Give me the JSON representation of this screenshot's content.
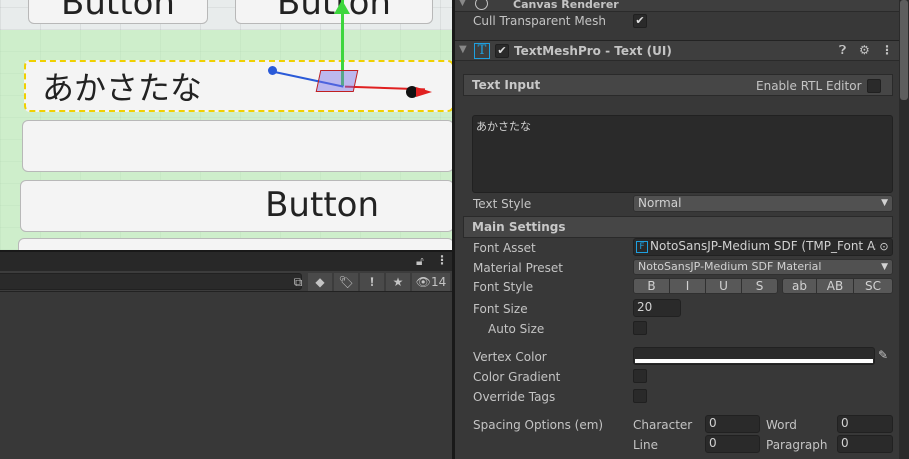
{
  "scene": {
    "button_label": "Button",
    "selected_text": "あかさたな"
  },
  "hierarchy": {
    "visible_count": "14"
  },
  "inspector": {
    "canvas_renderer_title": "Canvas Renderer",
    "cull_transparent_mesh_label": "Cull Transparent Mesh",
    "cull_transparent_mesh": true,
    "component_title": "TextMeshPro - Text (UI)",
    "component_enabled": true,
    "text_input": {
      "header": "Text Input",
      "rtl_label": "Enable RTL Editor",
      "rtl": false,
      "value": "あかさたな"
    },
    "text_style": {
      "label": "Text Style",
      "value": "Normal"
    },
    "main_settings": {
      "header": "Main Settings",
      "font_asset": {
        "label": "Font Asset",
        "value": "NotoSansJP-Medium SDF (TMP_Font Asset)"
      },
      "material_preset": {
        "label": "Material Preset",
        "value": "NotoSansJP-Medium SDF Material"
      },
      "font_style": {
        "label": "Font Style",
        "buttons": [
          "B",
          "I",
          "U",
          "S",
          "ab",
          "AB",
          "SC"
        ]
      },
      "font_size": {
        "label": "Font Size",
        "value": "20"
      },
      "auto_size": {
        "label": "Auto Size",
        "value": false
      },
      "vertex_color": {
        "label": "Vertex Color",
        "value": "#ffffff"
      },
      "color_gradient": {
        "label": "Color Gradient",
        "value": false
      },
      "override_tags": {
        "label": "Override Tags",
        "value": false
      },
      "spacing": {
        "label": "Spacing Options (em)",
        "character_label": "Character",
        "character": "0",
        "word_label": "Word",
        "word": "0",
        "line_label": "Line",
        "line": "0",
        "paragraph_label": "Paragraph",
        "paragraph": "0"
      }
    }
  },
  "colors": {
    "accent": "#1ea0e0",
    "inspector_bg": "#383838",
    "scene_bg": "#e8ecec"
  }
}
